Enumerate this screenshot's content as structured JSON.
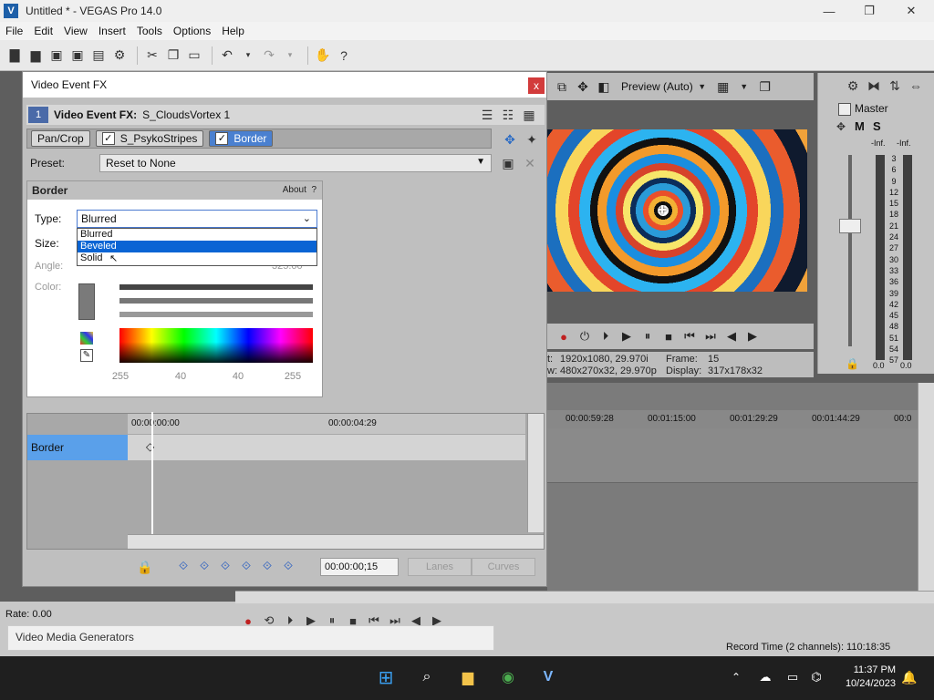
{
  "window": {
    "title": "Untitled * - VEGAS Pro 14.0",
    "app_icon": "V",
    "minimize": "—",
    "restore": "❐",
    "close": "✕"
  },
  "menu": [
    "File",
    "Edit",
    "View",
    "Insert",
    "Tools",
    "Options",
    "Help"
  ],
  "preview": {
    "quality": "Preview (Auto)",
    "project_label": "t:",
    "project_value": "1920x1080, 29.970i",
    "preview_label": "w:",
    "preview_value": "480x270x32, 29.970p",
    "frame_label": "Frame:",
    "frame_value": "15",
    "display_label": "Display:",
    "display_value": "317x178x32"
  },
  "master": {
    "label": "Master",
    "m_label": "M",
    "s_label": "S",
    "inf_left": "-Inf.",
    "inf_right": "-Inf.",
    "scale": [
      "3",
      "6",
      "9",
      "12",
      "15",
      "18",
      "21",
      "24",
      "27",
      "30",
      "33",
      "36",
      "39",
      "42",
      "45",
      "48",
      "51",
      "54",
      "57"
    ],
    "bottom_left": "0.0",
    "bottom_right": "0.0"
  },
  "timeline": {
    "ticks": [
      "00:00:59:28",
      "00:01:15:00",
      "00:01:29:29",
      "00:01:44:29",
      "00:0"
    ]
  },
  "fx": {
    "title": "Video Event FX",
    "close_label": "x",
    "index": "1",
    "header_label": "Video Event FX:",
    "header_name": "S_CloudsVortex 1",
    "chain": [
      {
        "label": "Pan/Crop",
        "checked": false,
        "active": false
      },
      {
        "label": "S_PsykoStripes",
        "checked": true,
        "active": false
      },
      {
        "label": "Border",
        "checked": true,
        "active": true
      }
    ],
    "preset_label": "Preset:",
    "preset_value": "Reset to None"
  },
  "border": {
    "heading": "Border",
    "about": "About",
    "help": "?",
    "type_label": "Type:",
    "type_value": "Blurred",
    "options": [
      "Blurred",
      "Beveled",
      "Solid"
    ],
    "size_label": "Size:",
    "angle_label": "Angle:",
    "angle_value": "325.00",
    "color_label": "Color:",
    "color_values": [
      "255",
      "40",
      "40",
      "255"
    ]
  },
  "keyframes": {
    "track_label": "Border",
    "ruler_ticks": [
      "00:00:00:00",
      "00:00:04:29"
    ],
    "time_value": "00:00:00;15",
    "lanes": "Lanes",
    "curves": "Curves"
  },
  "status": {
    "rate": "Rate: 0.00",
    "panel": "Video Media Generators",
    "record_time": "Record Time (2 channels): 110:18:35"
  },
  "taskbar": {
    "time": "11:37 PM",
    "date": "10/24/2023"
  }
}
